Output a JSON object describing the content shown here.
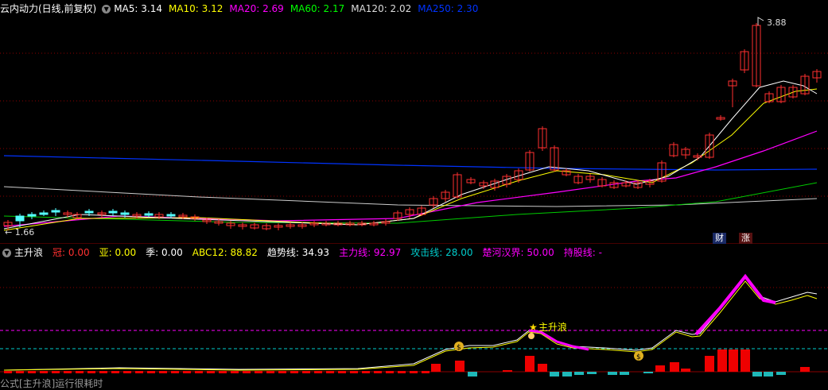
{
  "main_header": {
    "title": "云内动力(日线,前复权)",
    "ma": [
      {
        "label": "MA5: 3.14",
        "color": "#ffffff"
      },
      {
        "label": "MA10: 3.12",
        "color": "#ffff00"
      },
      {
        "label": "MA20: 2.69",
        "color": "#ff00ff"
      },
      {
        "label": "MA60: 2.17",
        "color": "#00ff00"
      },
      {
        "label": "MA120: 2.02",
        "color": "#dddddd"
      },
      {
        "label": "MA250: 2.30",
        "color": "#0033ff"
      }
    ]
  },
  "price_marks": {
    "high": "3.88",
    "low": "1.66"
  },
  "badges": {
    "cai": "财",
    "zhang": "涨"
  },
  "sub_header": {
    "title": "主升浪",
    "items": [
      {
        "label": "冠: 0.00",
        "color": "#ff3030"
      },
      {
        "label": "亚: 0.00",
        "color": "#ffff00"
      },
      {
        "label": "季: 0.00",
        "color": "#ffffff"
      },
      {
        "label": "ABC12: 88.82",
        "color": "#ffff00"
      },
      {
        "label": "趋势线: 34.93",
        "color": "#ffffff"
      },
      {
        "label": "主力线: 92.97",
        "color": "#ff00ff"
      },
      {
        "label": "攻击线: 28.00",
        "color": "#00cccc"
      },
      {
        "label": "楚河汉界: 50.00",
        "color": "#ff00ff"
      },
      {
        "label": "持股线: -",
        "color": "#ff00ff"
      }
    ]
  },
  "annotation": "主升浪",
  "footer": "公式[主升浪]运行很耗时",
  "colors": {
    "up": "#ff3030",
    "down": "#55ffff",
    "grid": "#8b0000"
  }
}
